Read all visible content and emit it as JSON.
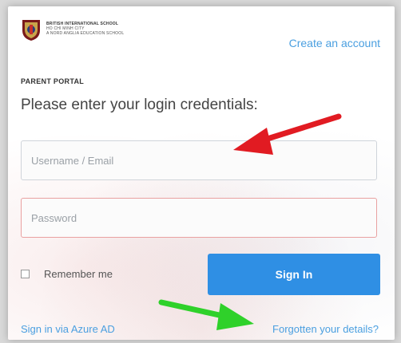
{
  "header": {
    "school_line1": "BRITISH INTERNATIONAL SCHOOL",
    "school_line2": "HO CHI MINH CITY",
    "school_line3": "A NORD ANGLIA EDUCATION SCHOOL",
    "create_account": "Create an account"
  },
  "form": {
    "section": "PARENT PORTAL",
    "prompt": "Please enter your login credentials:",
    "username": {
      "placeholder": "Username / Email",
      "value": ""
    },
    "password": {
      "placeholder": "Password",
      "value": ""
    },
    "remember_label": "Remember me",
    "signin_label": "Sign In"
  },
  "footer": {
    "azure_link": "Sign in via Azure AD",
    "forgot_link": "Forgotten your details?"
  },
  "colors": {
    "link": "#4a9fe0",
    "button": "#2f8fe4",
    "red_arrow": "#e11b22",
    "green_arrow": "#2fd12a",
    "password_border": "#e9a1a1"
  },
  "icons": [
    "school-crest-icon",
    "checkbox-icon",
    "red-arrow-annotation",
    "green-arrow-annotation"
  ]
}
